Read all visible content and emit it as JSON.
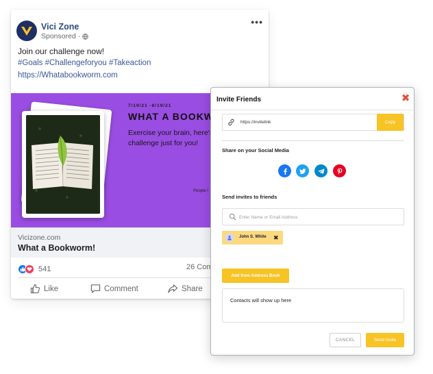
{
  "post": {
    "author": "Vici Zone",
    "sponsored": "Sponsored ·",
    "more": "•••",
    "text": "Join our challenge now!",
    "hashtags": "#Goals #Challengeforyou #Takeaction",
    "link": "https://Whatabookworm.com",
    "banner": {
      "dates": "7/19/21 -8/19/21",
      "title": "WHAT A BOOKWO",
      "description": "Exercise your brain, here's a challenge just for you!",
      "footer": "People l"
    },
    "link_preview": {
      "domain": "Vicizone.com",
      "title": "What a Bookworm!"
    },
    "reaction_count": "541",
    "comments_count": "26 Com",
    "actions": {
      "like": "Like",
      "comment": "Comment",
      "share": "Share"
    }
  },
  "modal": {
    "title": "Invite Friends",
    "invite_link": "https://invitelink",
    "copy_label": "Copy",
    "share_label": "Share on your Social Media",
    "social": [
      {
        "name": "facebook",
        "color": "#1877f2"
      },
      {
        "name": "twitter",
        "color": "#1da1f2"
      },
      {
        "name": "telegram",
        "color": "#0088cc"
      },
      {
        "name": "pinterest",
        "color": "#e60023"
      }
    ],
    "invite_label": "Send invites to friends",
    "search_placeholder": "Enter Name or Email Address",
    "chip_name": "John S. White",
    "chip_remove": "✖",
    "address_book_label": "Add from Address Book",
    "contacts_placeholder": "Contacts will show up here",
    "cancel_label": "CANCEL",
    "send_label": "Send Invite"
  },
  "colors": {
    "accent": "#f7c325",
    "banner": "#9a4de2",
    "close": "#e74c3c",
    "link": "#385898"
  }
}
